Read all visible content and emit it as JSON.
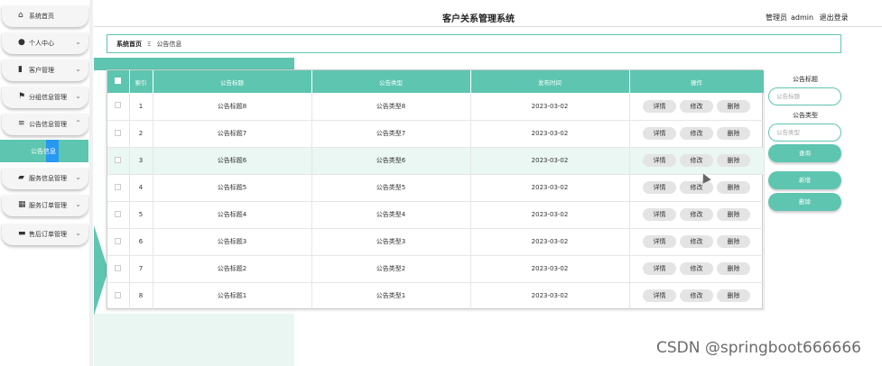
{
  "header": {
    "title": "客户关系管理系统",
    "role": "管理员",
    "username": "admin",
    "logout_label": "退出登录"
  },
  "sidebar": {
    "items": [
      {
        "label": "系统首页",
        "icon": "home-icon",
        "has_chevron": false
      },
      {
        "label": "个人中心",
        "icon": "user-icon",
        "has_chevron": true
      },
      {
        "label": "客户管理",
        "icon": "chart-icon",
        "has_chevron": true
      },
      {
        "label": "分组信息管理",
        "icon": "flag-icon",
        "has_chevron": true
      },
      {
        "label": "公告信息管理",
        "icon": "list-icon",
        "has_chevron": true
      },
      {
        "label": "服务信息管理",
        "icon": "folder-icon",
        "has_chevron": true
      },
      {
        "label": "服务订单管理",
        "icon": "grid-icon",
        "has_chevron": true
      },
      {
        "label": "售后订单管理",
        "icon": "inbox-icon",
        "has_chevron": true
      }
    ],
    "active_sub": "公告信息"
  },
  "breadcrumb": {
    "home": "系统首页",
    "separator": "Ξ",
    "current": "公告信息"
  },
  "table": {
    "headers": [
      "索引",
      "公告标题",
      "公告类型",
      "发布时间",
      "操作"
    ],
    "rows": [
      {
        "index": "1",
        "title": "公告标题8",
        "type": "公告类型8",
        "date": "2023-03-02"
      },
      {
        "index": "2",
        "title": "公告标题7",
        "type": "公告类型7",
        "date": "2023-03-02"
      },
      {
        "index": "3",
        "title": "公告标题6",
        "type": "公告类型6",
        "date": "2023-03-02"
      },
      {
        "index": "4",
        "title": "公告标题5",
        "type": "公告类型5",
        "date": "2023-03-02"
      },
      {
        "index": "5",
        "title": "公告标题4",
        "type": "公告类型4",
        "date": "2023-03-02"
      },
      {
        "index": "6",
        "title": "公告标题3",
        "type": "公告类型3",
        "date": "2023-03-02"
      },
      {
        "index": "7",
        "title": "公告标题2",
        "type": "公告类型2",
        "date": "2023-03-02"
      },
      {
        "index": "8",
        "title": "公告标题1",
        "type": "公告类型1",
        "date": "2023-03-02"
      }
    ],
    "actions": {
      "detail": "详情",
      "edit": "修改",
      "delete": "删除"
    }
  },
  "search": {
    "title_label": "公告标题",
    "title_placeholder": "公告标题",
    "type_label": "公告类型",
    "type_placeholder": "公告类型",
    "query_label": "查询",
    "add_label": "新增",
    "delete_label": "删除"
  },
  "watermark": "CSDN @springboot666666",
  "colors": {
    "accent": "#5ec5b0",
    "highlight_row": "#eaf7f3"
  }
}
